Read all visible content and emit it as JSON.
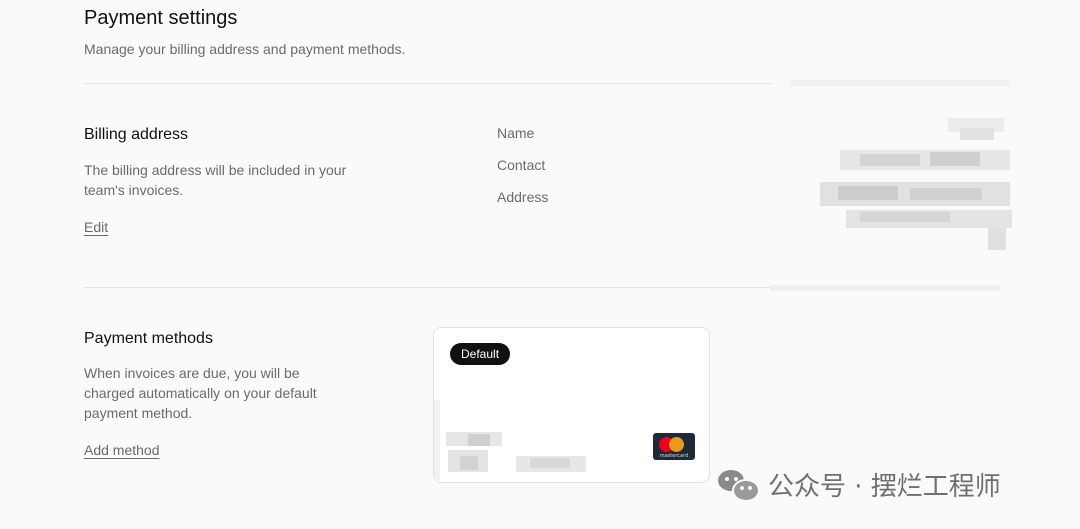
{
  "header": {
    "title": "Payment settings",
    "subtitle": "Manage your billing address and payment methods."
  },
  "billing": {
    "title": "Billing address",
    "description": "The billing address will be included in your team's invoices.",
    "edit_label": "Edit",
    "fields": [
      {
        "label": "Name"
      },
      {
        "label": "Contact"
      },
      {
        "label": "Address"
      }
    ]
  },
  "payment_methods": {
    "title": "Payment methods",
    "description": "When invoices are due, you will be charged automatically on your default payment method.",
    "add_label": "Add method",
    "card": {
      "badge": "Default",
      "brand": "mastercard"
    }
  },
  "watermark": {
    "text": "公众号 · 摆烂工程师"
  },
  "colors": {
    "background": "#fafafa",
    "text_primary": "#111111",
    "text_secondary": "#6b6b6b",
    "badge_bg": "#111111",
    "mastercard_red": "#eb001b",
    "mastercard_orange": "#f79e1b"
  },
  "icons": [
    "mastercard-logo-icon",
    "wechat-icon"
  ]
}
